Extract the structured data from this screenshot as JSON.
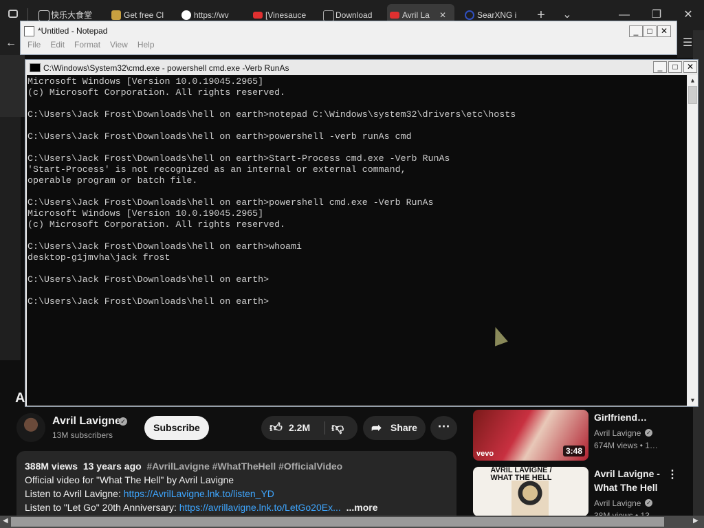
{
  "browser": {
    "tabs": [
      {
        "label": "快乐大食堂",
        "color": "#ffffff"
      },
      {
        "label": "Get free Cl",
        "color": "#c8a040"
      },
      {
        "label": "https://wv",
        "color": "#4285f4"
      },
      {
        "label": "[Vinesauce",
        "color": "#e03030"
      },
      {
        "label": "Download",
        "color": "#888888"
      },
      {
        "label": "Avril La",
        "color": "#e03030"
      },
      {
        "label": "SearXNG i",
        "color": "#3050c0"
      }
    ],
    "controls": {
      "new_tab": "+",
      "dropdown": "⌄",
      "minimize": "—",
      "restore": "❐",
      "close": "✕"
    }
  },
  "notepad": {
    "title": "*Untitled - Notepad",
    "menu": [
      "File",
      "Edit",
      "Format",
      "View",
      "Help"
    ],
    "controls": {
      "minimize": "_",
      "maximize": "□",
      "close": "✕"
    }
  },
  "cmd": {
    "title": "C:\\Windows\\System32\\cmd.exe - powershell  cmd.exe -Verb RunAs",
    "controls": {
      "minimize": "_",
      "maximize": "□",
      "close": "✕"
    },
    "output": "Microsoft Windows [Version 10.0.19045.2965]\n(c) Microsoft Corporation. All rights reserved.\n\nC:\\Users\\Jack Frost\\Downloads\\hell on earth>notepad C:\\Windows\\system32\\drivers\\etc\\hosts\n\nC:\\Users\\Jack Frost\\Downloads\\hell on earth>powershell -verb runAs cmd\n\nC:\\Users\\Jack Frost\\Downloads\\hell on earth>Start-Process cmd.exe -Verb RunAs\n'Start-Process' is not recognized as an internal or external command,\noperable program or batch file.\n\nC:\\Users\\Jack Frost\\Downloads\\hell on earth>powershell cmd.exe -Verb RunAs\nMicrosoft Windows [Version 10.0.19045.2965]\n(c) Microsoft Corporation. All rights reserved.\n\nC:\\Users\\Jack Frost\\Downloads\\hell on earth>whoami\ndesktop-g1jmvha\\jack frost\n\nC:\\Users\\Jack Frost\\Downloads\\hell on earth>\n\nC:\\Users\\Jack Frost\\Downloads\\hell on earth>"
  },
  "youtube": {
    "channel": {
      "name": "Avril Lavigne",
      "subscribers": "13M subscribers"
    },
    "subscribe_label": "Subscribe",
    "likes": "2.2M",
    "share_label": "Share",
    "more_icon": "⋯",
    "description": {
      "views": "388M views",
      "date": "13 years ago",
      "tags": "#AvrilLavigne #WhatTheHell #OfficialVideo",
      "line1": "Official video for \"What The Hell\" by Avril Lavigne",
      "line2_prefix": "Listen to Avril Lavigne: ",
      "line2_link": "https://AvrilLavigne.lnk.to/listen_YD",
      "line3_prefix": "Listen to \"Let Go\" 20th Anniversary: ",
      "line3_link": "https://avrillavigne.lnk.to/LetGo20Ex...",
      "more": "...more"
    },
    "recommendations": [
      {
        "title": "Girlfriend…",
        "channel": "Avril Lavigne",
        "meta": "674M views  • 1…",
        "duration": "3:48",
        "badge": "vevo"
      },
      {
        "title": "Avril Lavigne - What The Hell",
        "channel": "Avril Lavigne",
        "meta": "38M views  • 13…",
        "thumb_text": "AVRIL LAVIGNE / WHAT THE HELL"
      }
    ],
    "accent_red": "#e03030",
    "link_color": "#3ea6ff"
  }
}
